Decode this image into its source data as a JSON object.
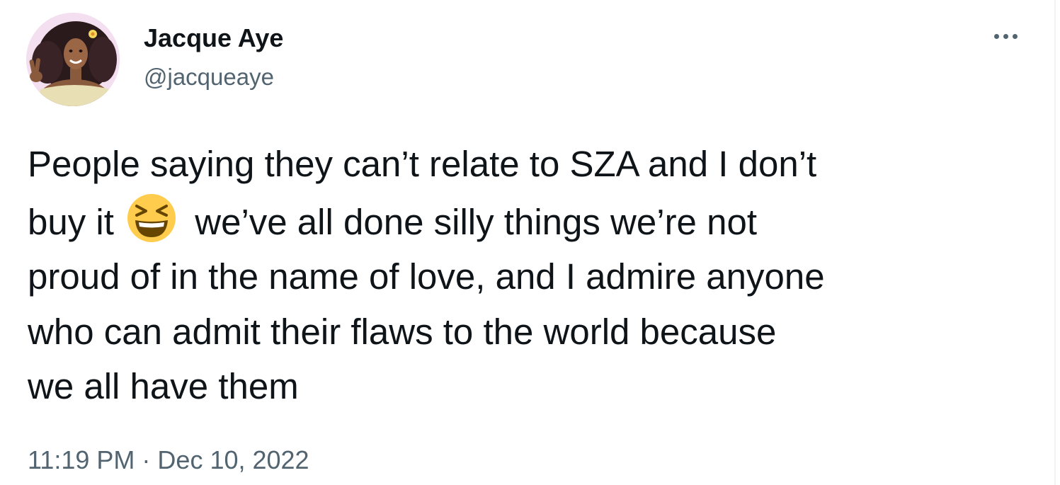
{
  "author": {
    "name": "Jacque Aye",
    "handle": "@jacqueaye",
    "avatar_icon": "profile-avatar-illustration"
  },
  "menu": {
    "icon": "more-horizontal-icon"
  },
  "tweet": {
    "line1": "People saying they can’t relate to SZA and I don’t",
    "line2_before": "buy it",
    "line2_emoji": "grinning-squinting-face-emoji",
    "line2_after": "we’ve all done silly things we’re not",
    "line3": "proud of in the name of love, and I admire anyone",
    "line4": "who can admit their flaws to the world because",
    "line5": "we all have them"
  },
  "meta": {
    "time": "11:19 PM",
    "separator": "·",
    "date": "Dec 10, 2022"
  },
  "colors": {
    "text_primary": "#0f1419",
    "text_secondary": "#536471",
    "emoji_yellow": "#ffcc4d"
  }
}
